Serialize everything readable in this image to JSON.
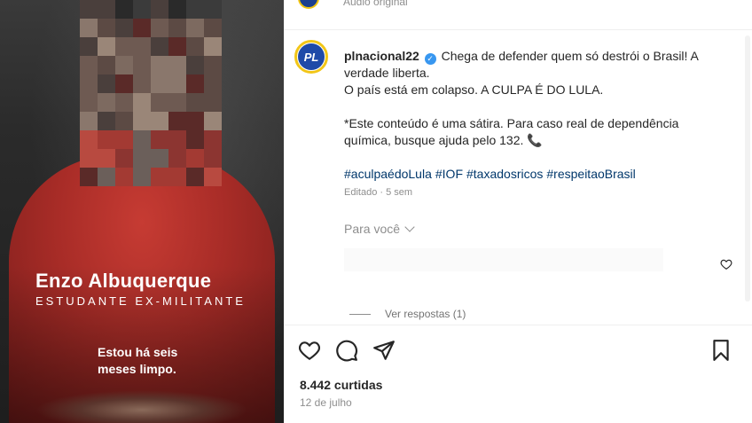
{
  "media": {
    "person_name": "Enzo Albuquerque",
    "person_role": "ESTUDANTE EX-MILITANTE",
    "caption": "Estou há seis meses limpo."
  },
  "header": {
    "audio_label": "Áudio original"
  },
  "post": {
    "username": "plnacional22",
    "avatar_text": "PL",
    "verified_icon": "verified-badge-icon",
    "line1": "Chega de defender quem só destrói o Brasil! A verdade liberta.",
    "line2": "O país está em colapso. A CULPA É DO LULA.",
    "line3": "*Este conteúdo é uma sátira. Para caso real de dependência química, busque ajuda pelo 132.",
    "phone_emoji": "📞",
    "hashtags": [
      "#aculpaédoLula",
      "#IOF",
      "#taxadosricos",
      "#respeitaoBrasil"
    ],
    "edited": "Editado · 5 sem"
  },
  "comments": {
    "for_you_label": "Para você",
    "view_replies": "Ver respostas (1)"
  },
  "actions": {
    "icons": [
      "heart-icon",
      "comment-icon",
      "share-icon",
      "bookmark-icon"
    ]
  },
  "stats": {
    "likes": "8.442 curtidas",
    "date": "12 de julho"
  },
  "colors": {
    "link": "#00376b",
    "muted": "#8e8e8e",
    "verified": "#3897f0",
    "shirt": "#b3302a",
    "brand_yellow": "#f2c617",
    "brand_blue": "#1f4aa8"
  }
}
